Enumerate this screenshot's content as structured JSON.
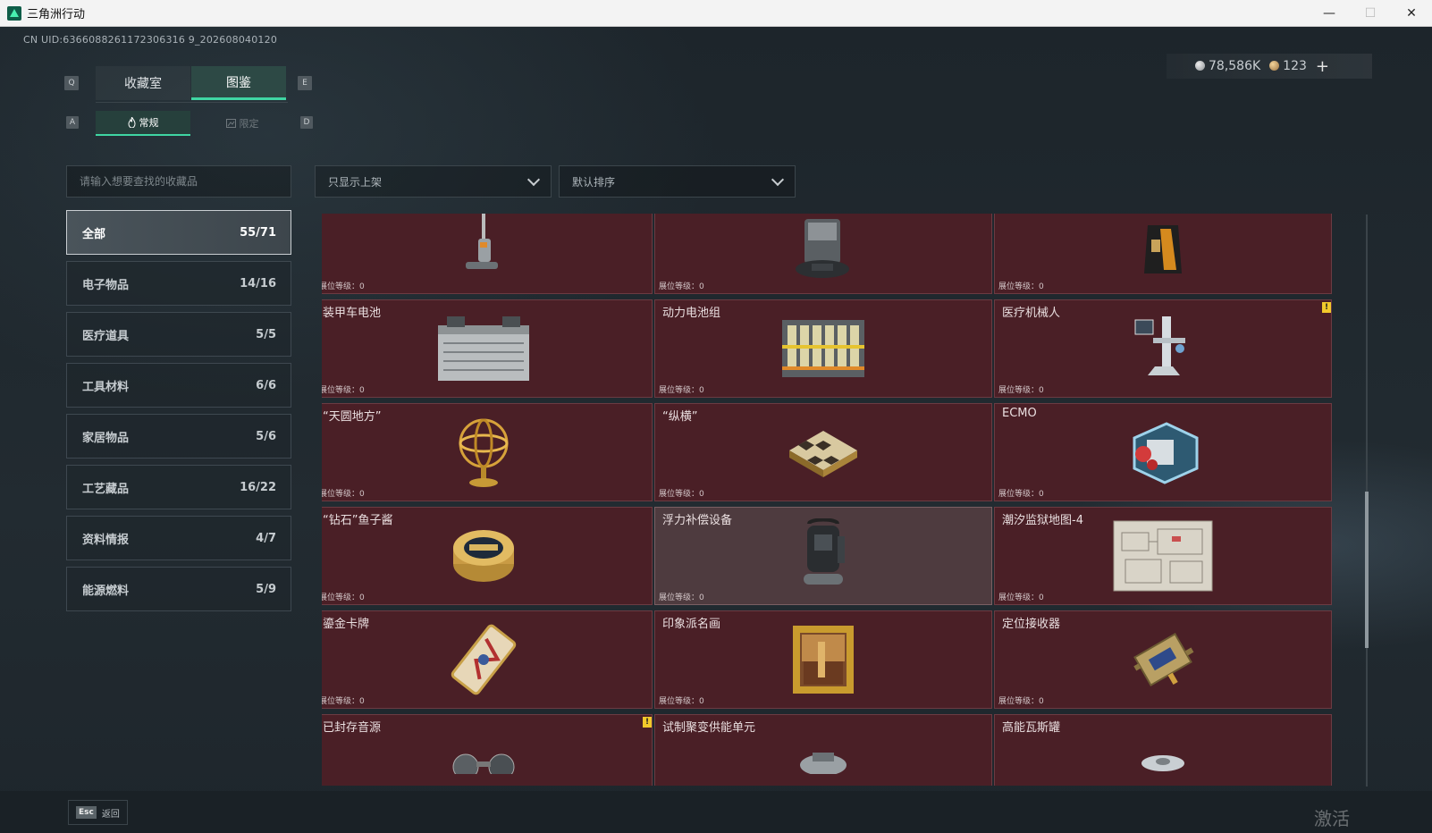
{
  "window": {
    "title": "三角洲行动",
    "controls": [
      "—",
      "☐",
      "✕"
    ]
  },
  "header": {
    "uid": "CN UID:6366088261172306316 9_202608040120",
    "currency": {
      "silver": "78,586K",
      "gold": "123",
      "add": "+"
    },
    "key_q": "Q",
    "key_e": "E",
    "key_a": "A",
    "key_d": "D"
  },
  "tabs": {
    "collection_room": "收藏室",
    "catalog": "图鉴",
    "regular": "常规",
    "limited": "限定"
  },
  "filters": {
    "search_placeholder": "请输入想要查找的收藏品",
    "shelf_filter": "只显示上架",
    "sort": "默认排序"
  },
  "categories": [
    {
      "label": "全部",
      "count": "55/71"
    },
    {
      "label": "电子物品",
      "count": "14/16"
    },
    {
      "label": "医疗道具",
      "count": "5/5"
    },
    {
      "label": "工具材料",
      "count": "6/6"
    },
    {
      "label": "家居物品",
      "count": "5/6"
    },
    {
      "label": "工艺藏品",
      "count": "16/22"
    },
    {
      "label": "资料情报",
      "count": "4/7"
    },
    {
      "label": "能源燃料",
      "count": "5/9"
    }
  ],
  "level_label": "展位等级：0",
  "items": [
    {
      "name": "",
      "icon": "vacuum-cleaner-icon"
    },
    {
      "name": "",
      "icon": "robot-vacuum-icon"
    },
    {
      "name": "",
      "icon": "coffee-bag-icon"
    },
    {
      "name": "装甲车电池",
      "icon": "car-battery-icon"
    },
    {
      "name": "动力电池组",
      "icon": "battery-pack-icon"
    },
    {
      "name": "医疗机械人",
      "icon": "medical-robot-icon",
      "warn": "!"
    },
    {
      "name": "“天圆地方”",
      "icon": "armillary-sphere-icon"
    },
    {
      "name": "“纵横”",
      "icon": "chess-board-icon"
    },
    {
      "name": "ECMO",
      "icon": "ecmo-machine-icon"
    },
    {
      "name": "“钻石”鱼子酱",
      "icon": "caviar-tin-icon"
    },
    {
      "name": "浮力补偿设备",
      "icon": "buoyancy-device-icon"
    },
    {
      "name": "潮汐监狱地图-4",
      "icon": "prison-map-icon"
    },
    {
      "name": "鎏金卡牌",
      "icon": "gilded-card-icon"
    },
    {
      "name": "印象派名画",
      "icon": "framed-painting-icon"
    },
    {
      "name": "定位接收器",
      "icon": "gps-receiver-icon"
    },
    {
      "name": "已封存音源",
      "icon": "sealed-audio-icon",
      "warn": "!"
    },
    {
      "name": "试制聚变供能单元",
      "icon": "fusion-unit-icon"
    },
    {
      "name": "高能瓦斯罐",
      "icon": "gas-canister-icon"
    }
  ],
  "footer": {
    "esc_key": "Esc",
    "back": "返回",
    "watermark": "激活 Windows"
  }
}
